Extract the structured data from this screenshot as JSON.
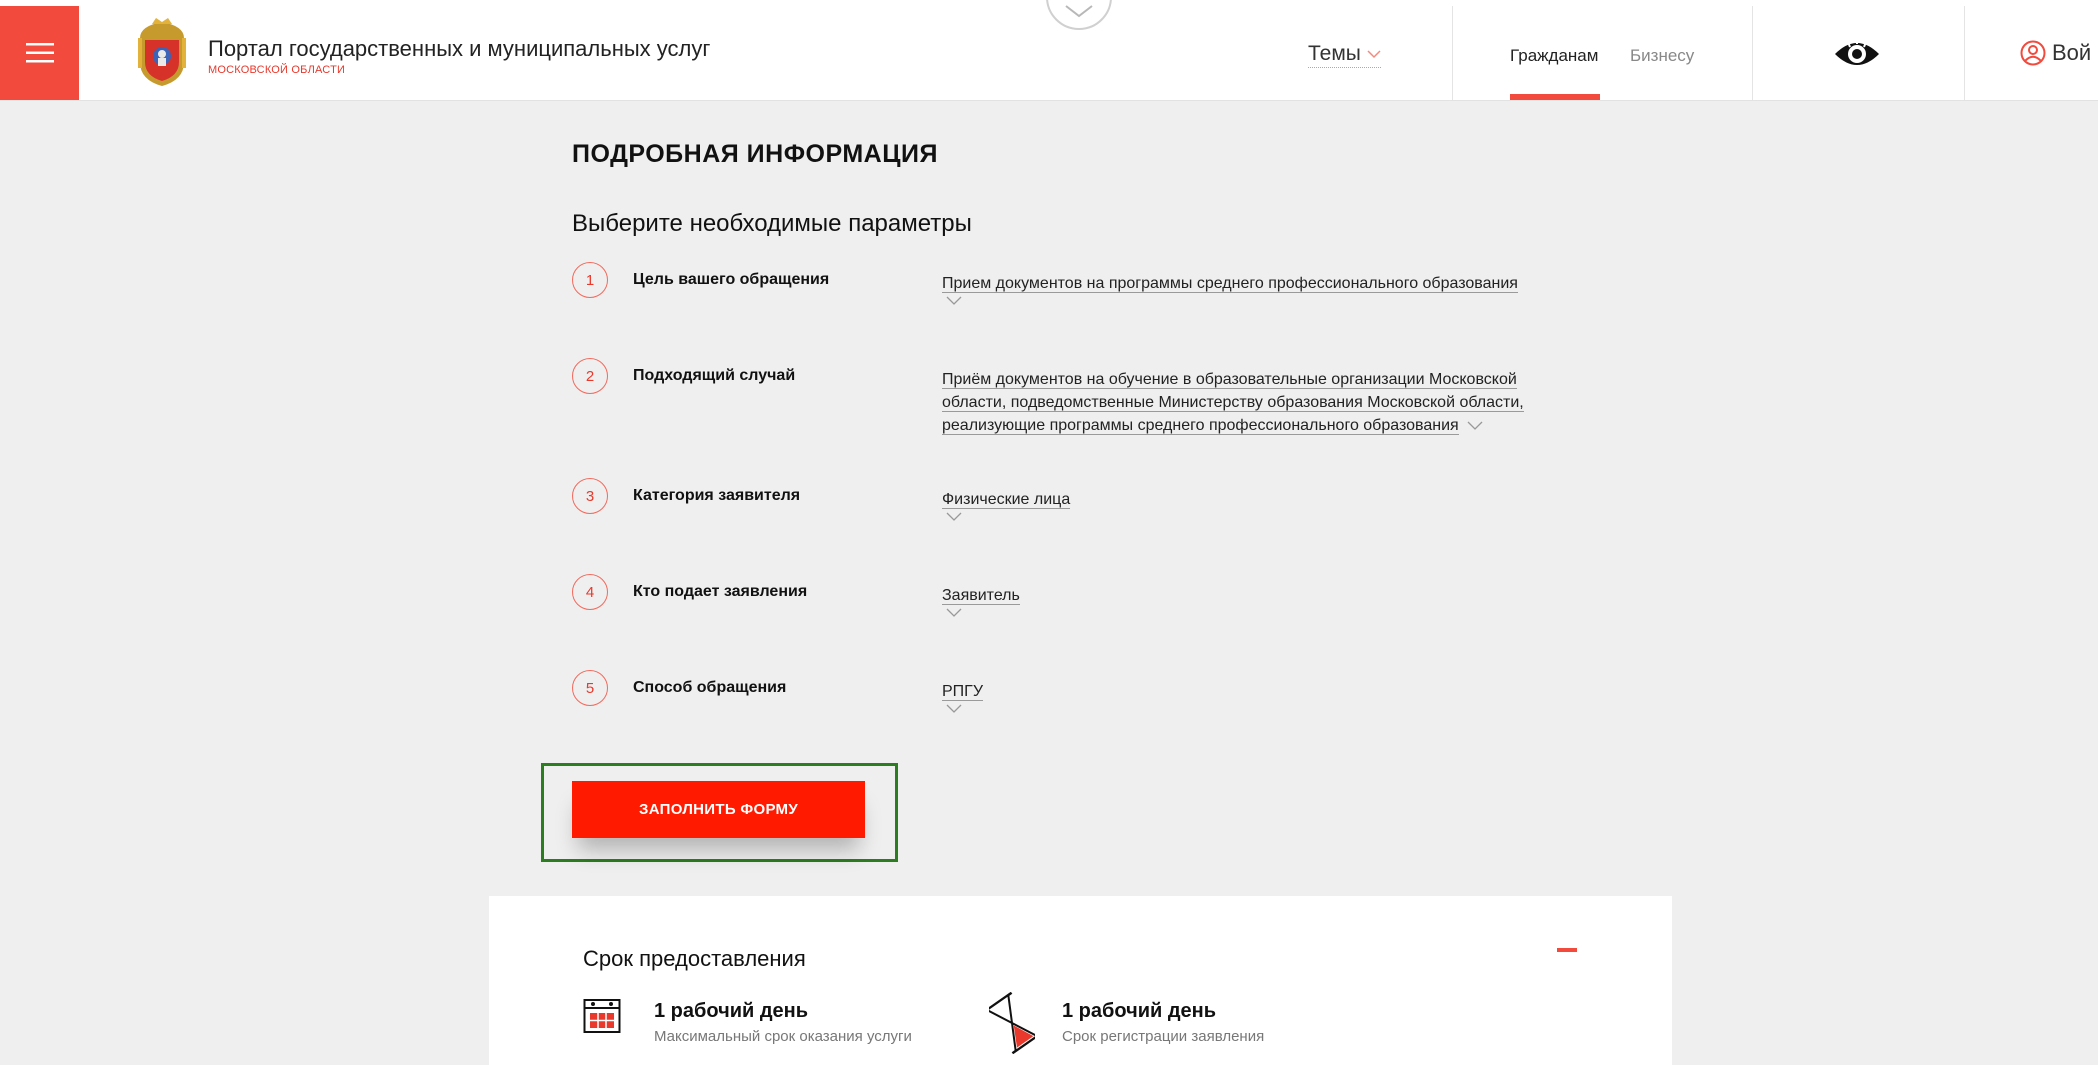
{
  "header": {
    "portal_title": "Портал государственных и муниципальных услуг",
    "portal_subtitle": "МОСКОВСКОЙ ОБЛАСТИ",
    "themes_label": "Темы",
    "nav_citizens": "Гражданам",
    "nav_business": "Бизнесу",
    "login_label": "Вой"
  },
  "main": {
    "section_title": "ПОДРОБНАЯ ИНФОРМАЦИЯ",
    "subtitle": "Выберите необходимые параметры",
    "params": [
      {
        "num": "1",
        "label": "Цель вашего обращения",
        "value": "Прием документов на программы среднего профессионального образования"
      },
      {
        "num": "2",
        "label": "Подходящий случай",
        "value_lines": [
          "Приём документов на обучение в образовательные организации Московской",
          "области, подведомственные Министерству образования Московской области,",
          "реализующие программы среднего профессионального образования"
        ]
      },
      {
        "num": "3",
        "label": "Категория заявителя",
        "value": "Физические лица"
      },
      {
        "num": "4",
        "label": "Кто подает заявления",
        "value": "Заявитель"
      },
      {
        "num": "5",
        "label": "Способ обращения",
        "value": "РПГУ"
      }
    ],
    "fill_form_button": "ЗАПОЛНИТЬ ФОРМУ"
  },
  "term_card": {
    "title": "Срок предоставления",
    "items": [
      {
        "title": "1 рабочий день",
        "subtitle": "Максимальный срок оказания услуги",
        "icon": "calendar-icon"
      },
      {
        "title": "1 рабочий день",
        "subtitle": "Срок регистрации заявления",
        "icon": "hourglass-icon"
      }
    ]
  },
  "colors": {
    "accent": "#f24a3d",
    "button": "#ff1a00",
    "highlight_border": "#2c7d1f",
    "background": "#efefef"
  }
}
